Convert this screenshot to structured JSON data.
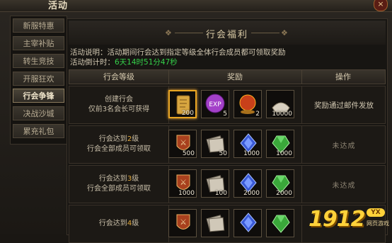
{
  "window": {
    "title": "活动",
    "close": "×"
  },
  "sidebar": {
    "items": [
      {
        "label": "新服特惠"
      },
      {
        "label": "主宰补贴"
      },
      {
        "label": "转生竞技"
      },
      {
        "label": "开服狂欢"
      },
      {
        "label": "行会争锋",
        "active": true
      },
      {
        "label": "决战沙城"
      },
      {
        "label": "累充礼包"
      }
    ]
  },
  "panel": {
    "title": "行会福利",
    "description": "活动说明：活动期间行会达到指定等级全体行会成员都可领取奖励",
    "countdown_label": "活动倒计时：",
    "countdown_value": "6天14时51分47秒"
  },
  "table": {
    "headers": [
      "行会等级",
      "奖励",
      "操作"
    ],
    "rows": [
      {
        "level_line1": "创建行会",
        "level_line2": "仅前3名会长可获得",
        "action": "奖励通过邮件发放",
        "items": [
          {
            "icon": "scroll-icon",
            "qty": "200",
            "selected": true
          },
          {
            "icon": "exp-orb-icon",
            "qty": "5"
          },
          {
            "icon": "red-orb-icon",
            "qty": "2"
          },
          {
            "icon": "gold-ingot-icon",
            "qty": "10000"
          }
        ]
      },
      {
        "level_prefix": "行会达到",
        "level_num": "2",
        "level_suffix": "级",
        "level_line2": "行会全部成员可领取",
        "action": "未达成",
        "items": [
          {
            "icon": "rune-shield-icon",
            "qty": "500"
          },
          {
            "icon": "paper-stack-icon",
            "qty": "50"
          },
          {
            "icon": "blue-crystal-icon",
            "qty": "1000"
          },
          {
            "icon": "green-gem-icon",
            "qty": "1000"
          }
        ]
      },
      {
        "level_prefix": "行会达到",
        "level_num": "3",
        "level_suffix": "级",
        "level_line2": "行会全部成员可领取",
        "action": "未达成",
        "items": [
          {
            "icon": "rune-shield-icon",
            "qty": "1000"
          },
          {
            "icon": "paper-stack-icon",
            "qty": "100"
          },
          {
            "icon": "blue-crystal-icon",
            "qty": "2000"
          },
          {
            "icon": "green-gem-icon",
            "qty": "2000"
          }
        ]
      },
      {
        "level_prefix": "行会达到",
        "level_num": "4",
        "level_suffix": "级",
        "level_line2": "",
        "action": "",
        "items": [
          {
            "icon": "rune-shield-icon",
            "qty": ""
          },
          {
            "icon": "paper-stack-icon",
            "qty": ""
          },
          {
            "icon": "blue-crystal-icon",
            "qty": ""
          },
          {
            "icon": "green-gem-icon",
            "qty": ""
          }
        ]
      }
    ]
  },
  "watermark": {
    "digits": "1912",
    "badge": "YX",
    "sub": "网页游戏"
  },
  "colors": {
    "accent_green": "#35d24a",
    "level_number": "#e0a83a",
    "selected_border": "#e8a523"
  }
}
